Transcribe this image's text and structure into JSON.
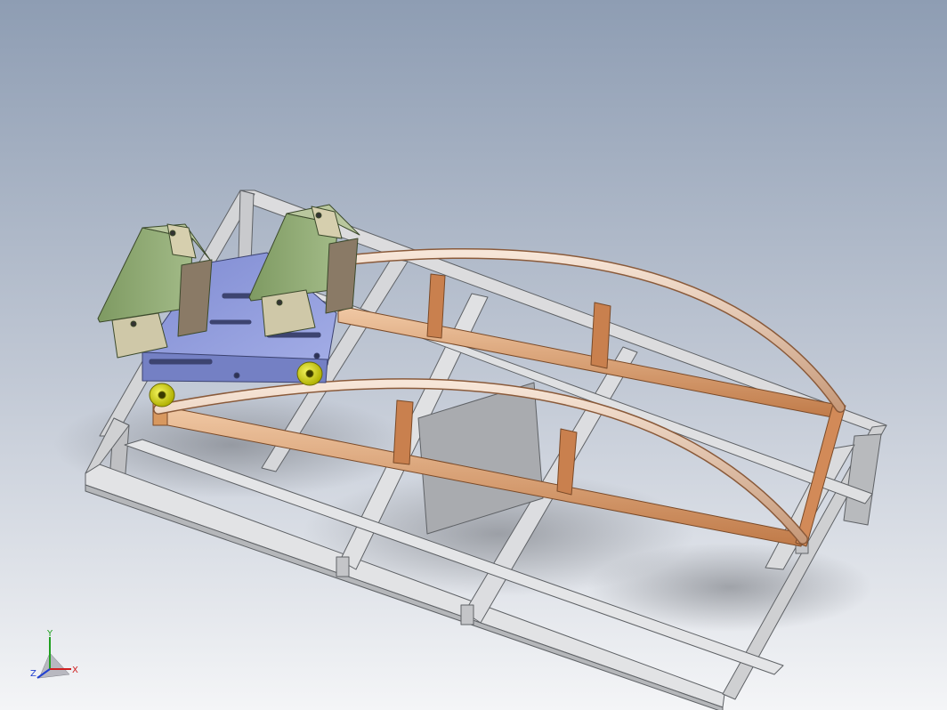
{
  "viewport": {
    "background_top": "#8e9db3",
    "background_bottom": "#f4f5f7"
  },
  "colors": {
    "frame_steel": "#d9dadb",
    "frame_steel_dark": "#8f9295",
    "rail_wood": "#e8b48c",
    "rail_wood_dark": "#a86a40",
    "arch_wood": "#f0d3bd",
    "carriage_plate": "#8c98d8",
    "seat_green": "#8fa873",
    "seat_bracket": "#cfc8a8",
    "wheel_yellow": "#d8d81a",
    "floor_panel": "#a7a9ad"
  },
  "triad": {
    "x_label": "X",
    "y_label": "Y",
    "z_label": "Z",
    "x_color": "#d02020",
    "y_color": "#20a020",
    "z_color": "#2040d0"
  }
}
